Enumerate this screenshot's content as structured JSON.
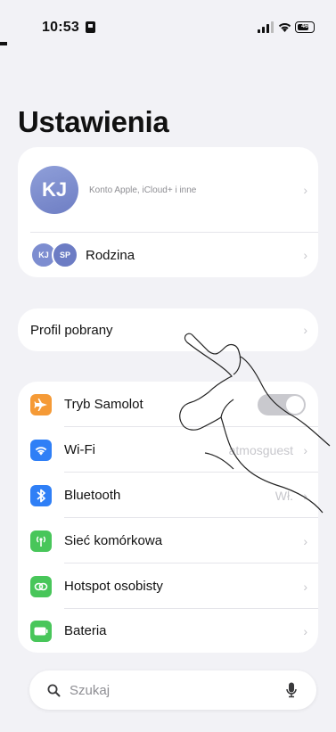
{
  "status": {
    "time": "10:53",
    "battery": "46"
  },
  "title": "Ustawienia",
  "account": {
    "initials": "KJ",
    "subtitle": "Konto Apple, iCloud+ i inne"
  },
  "family": {
    "avatars": [
      "KJ",
      "SP"
    ],
    "label": "Rodzina"
  },
  "profile": {
    "label": "Profil pobrany"
  },
  "settings": [
    {
      "label": "Tryb Samolot",
      "icon": "airplane-icon",
      "color": "#f59a36"
    },
    {
      "label": "Wi-Fi",
      "value": "atmosguest",
      "icon": "wifi-icon",
      "color": "#2f7ff6"
    },
    {
      "label": "Bluetooth",
      "value": "Wł.",
      "icon": "bluetooth-icon",
      "color": "#2f7ff6"
    },
    {
      "label": "Sieć komórkowa",
      "icon": "antenna-icon",
      "color": "#48c65a"
    },
    {
      "label": "Hotspot osobisty",
      "icon": "hotspot-icon",
      "color": "#48c65a"
    },
    {
      "label": "Bateria",
      "icon": "battery-icon",
      "color": "#48c65a"
    }
  ],
  "search": {
    "placeholder": "Szukaj"
  }
}
